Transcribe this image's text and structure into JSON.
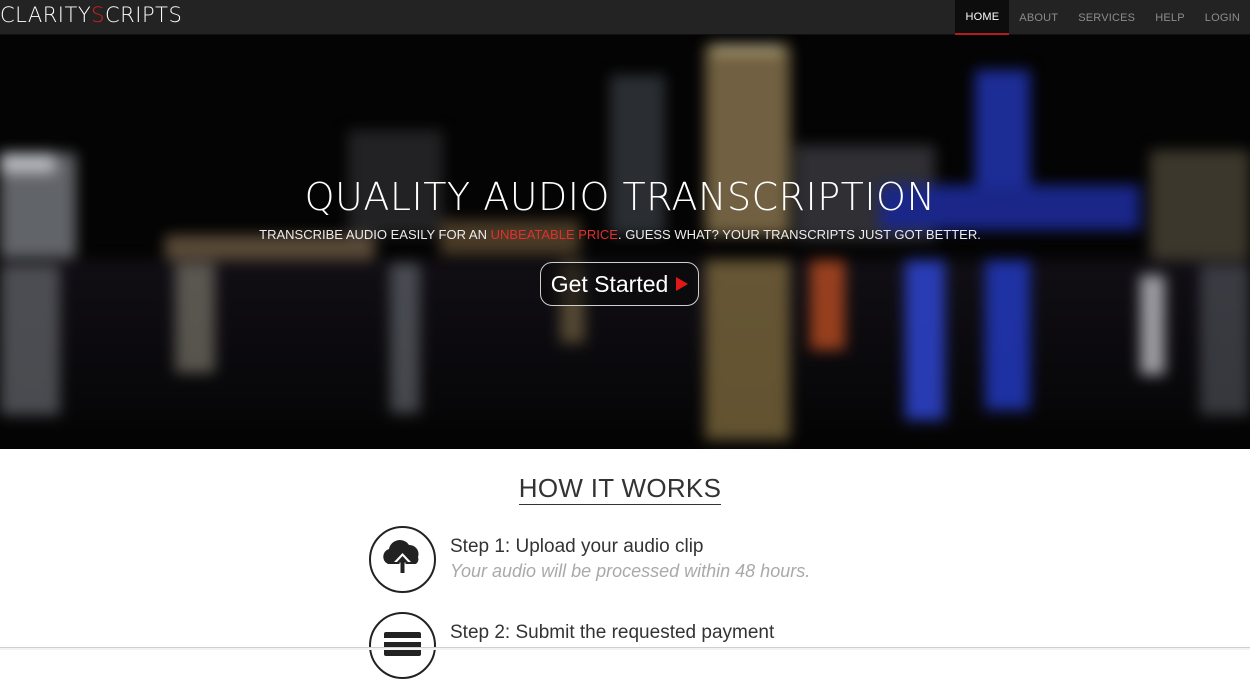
{
  "brand": {
    "part1": "CLARITY",
    "accent": "S",
    "part2": "CRIPTS",
    "accent_color": "#d61f1f"
  },
  "nav": {
    "items": [
      {
        "label": "HOME",
        "active": true
      },
      {
        "label": "ABOUT",
        "active": false
      },
      {
        "label": "SERVICES",
        "active": false
      },
      {
        "label": "HELP",
        "active": false
      },
      {
        "label": "LOGIN",
        "active": false
      }
    ]
  },
  "hero": {
    "title": "QUALITY AUDIO TRANSCRIPTION",
    "subtitle_before": "TRANSCRIBE AUDIO EASILY FOR AN ",
    "subtitle_highlight": "UNBEATABLE PRICE",
    "subtitle_after": ". GUESS WHAT? YOUR TRANSCRIPTS JUST GOT BETTER.",
    "cta_label": "Get Started",
    "cta_icon": "play-arrow-icon",
    "highlight_color": "#e0312d",
    "background": "blurred night city skyline reflected in water"
  },
  "how_it_works": {
    "title": "HOW IT WORKS",
    "steps": [
      {
        "title": "Step 1: Upload your audio clip",
        "description": "Your audio will be processed within 48 hours.",
        "icon": "cloud-upload-icon"
      },
      {
        "title": "Step 2: Submit the requested payment",
        "description": "",
        "icon": "credit-card-icon"
      }
    ]
  }
}
